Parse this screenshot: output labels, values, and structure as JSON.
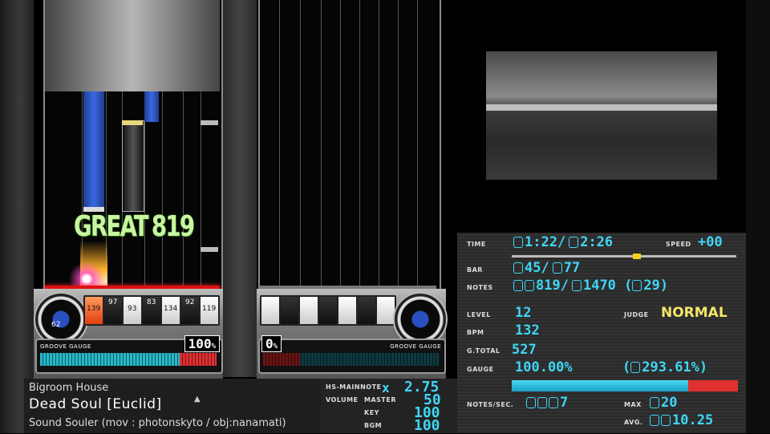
{
  "judge": {
    "text": "GREAT",
    "combo": "819"
  },
  "p1_keys": [
    "139",
    "97",
    "93",
    "83",
    "134",
    "92",
    "119"
  ],
  "turntable": {
    "p1_value": "62"
  },
  "gauge": {
    "label": "GROOVE GAUGE",
    "p1_percent": "100",
    "p2_percent": "0",
    "pct_sign": "%",
    "p1_fill": 1.0,
    "p2_fill": 0.0
  },
  "song": {
    "genre": "Bigroom House",
    "title": "Dead Soul [Euclid]",
    "artist": "Sound Souler (mov : photonskyto / obj:nanamati)"
  },
  "hs": {
    "mainnote_label": "HS-MAINNOTE",
    "mult_symbol": "x",
    "mainnote_value": "2.75",
    "volume_label": "VOLUME",
    "master_label": "MASTER",
    "master_value": "50",
    "key_label": "KEY",
    "key_value": "100",
    "bgm_label": "BGM",
    "bgm_value": "100"
  },
  "stats": {
    "time_label": "TIME",
    "time_current": "1:22",
    "time_total": "2:26",
    "speed_label": "SPEED",
    "speed_value": "+00",
    "progress": 0.56,
    "bar_label": "BAR",
    "bar_current": "45",
    "bar_total": "77",
    "notes_label": "NOTES",
    "notes_current": "819",
    "notes_total": "1470",
    "notes_extra": "29",
    "level_label": "LEVEL",
    "level_value": "12",
    "judge_label": "JUDGE",
    "judge_value": "NORMAL",
    "bpm_label": "BPM",
    "bpm_value": "132",
    "gtotal_label": "G.TOTAL",
    "gtotal_value": "527",
    "gauge_label": "GAUGE",
    "gauge_value": "100.00%",
    "gauge_extra": "293.61",
    "gauge_extra_unit": "%",
    "gauge_fill": 0.78,
    "nps_label": "NOTES/SEC.",
    "nps_value": "7",
    "max_label": "MAX",
    "max_value": "20",
    "avg_label": "AVG.",
    "avg_value": "10.25"
  },
  "colors": {
    "accent": "#3fd6f6",
    "judge_line": "#e01010",
    "gauge_red": "#e03030",
    "normal_text": "#f3e66a"
  }
}
